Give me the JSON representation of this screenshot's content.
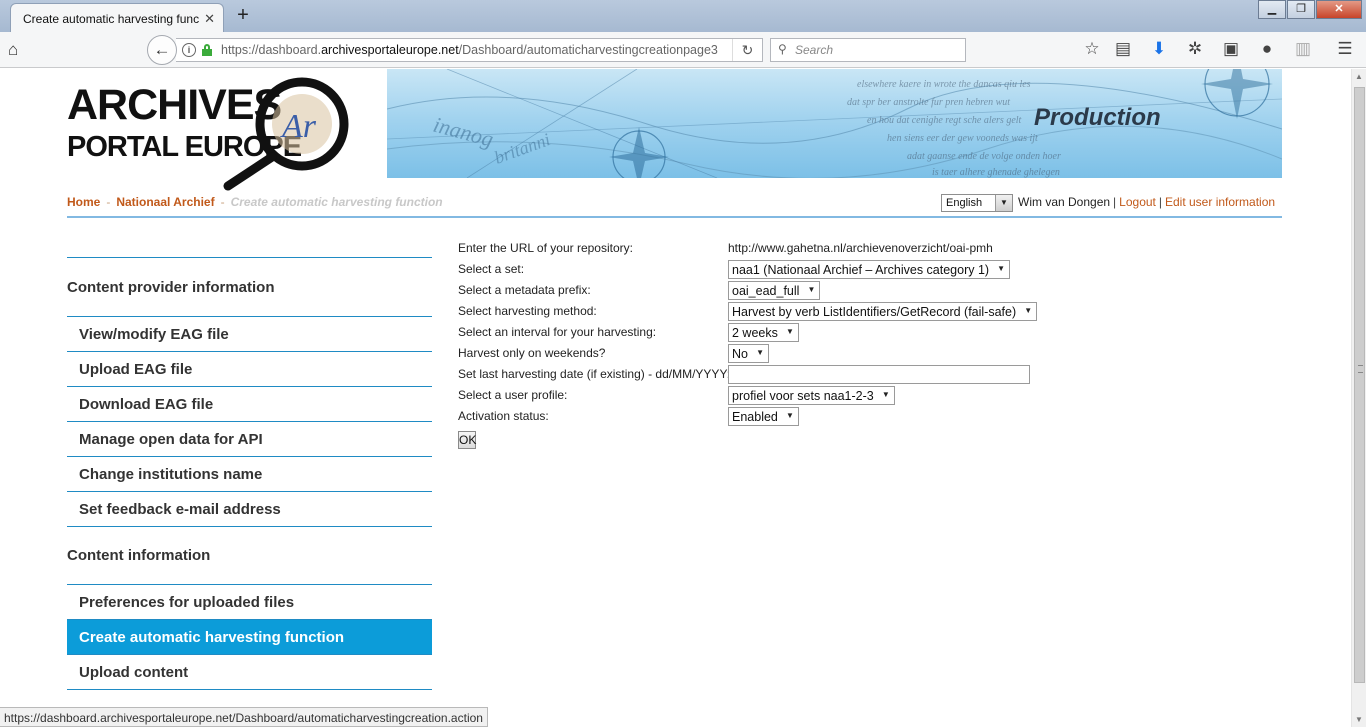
{
  "browser": {
    "tab_title": "Create automatic harvesting func",
    "tab_close": "✕",
    "new_tab": "+",
    "url_prefix": "https://dashboard.",
    "url_domain": "archivesportaleurope.net",
    "url_path": "/Dashboard/automaticharvestingcreationpage3",
    "search_placeholder": "Search",
    "status_url": "https://dashboard.archivesportaleurope.net/Dashboard/automaticharvestingcreation.action"
  },
  "header": {
    "logo_line1": "ARCHIVES",
    "logo_line2": "PORTAL EUROPE",
    "logo_mark": "Ar",
    "banner_title": "Production"
  },
  "breadcrumb": {
    "home": "Home",
    "institution": "Nationaal Archief",
    "current": "Create automatic harvesting function"
  },
  "user": {
    "language": "English",
    "name": "Wim van Dongen",
    "logout": "Logout",
    "edit": "Edit user information"
  },
  "sidebar": {
    "heading1": "Content provider information",
    "items1": [
      "View/modify EAG file",
      "Upload EAG file",
      "Download EAG file",
      "Manage open data for API",
      "Change institutions name",
      "Set feedback e-mail address"
    ],
    "heading2": "Content information",
    "items2": [
      "Preferences for uploaded files",
      "Create automatic harvesting function",
      "Upload content"
    ]
  },
  "form": {
    "url_label": "Enter the URL of your repository:",
    "url_value": "http://www.gahetna.nl/archievenoverzicht/oai-pmh",
    "set_label": "Select a set:",
    "set_value": "naa1 (Nationaal Archief – Archives category 1)",
    "prefix_label": "Select a metadata prefix:",
    "prefix_value": "oai_ead_full",
    "method_label": "Select harvesting method:",
    "method_value": "Harvest by verb ListIdentifiers/GetRecord (fail-safe)",
    "interval_label": "Select an interval for your harvesting:",
    "interval_value": "2 weeks",
    "weekends_label": "Harvest only on weekends?",
    "weekends_value": "No",
    "lastdate_label": "Set last harvesting date (if existing) - dd/MM/YYYY:",
    "lastdate_value": "",
    "profile_label": "Select a user profile:",
    "profile_value": "profiel voor sets naa1-2-3",
    "activation_label": "Activation status:",
    "activation_value": "Enabled",
    "ok_label": "OK"
  }
}
